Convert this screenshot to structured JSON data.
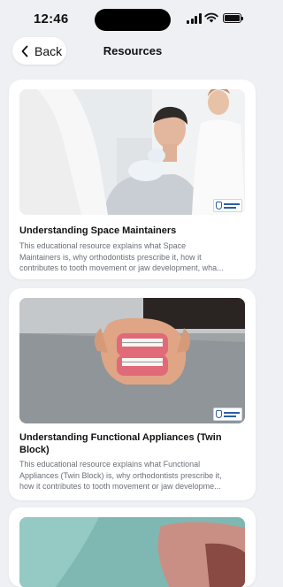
{
  "status_bar": {
    "time": "12:46"
  },
  "header": {
    "back_label": "Back",
    "title": "Resources"
  },
  "resources": [
    {
      "title": "Understanding Space Maintainers",
      "description_lines": [
        "This educational resource explains what Space",
        "Maintainers is, why orthodontists prescribe it, how it",
        "contributes to tooth movement or jaw development, wha..."
      ]
    },
    {
      "title_lines": [
        "Understanding Functional Appliances (Twin",
        "Block)"
      ],
      "description_lines": [
        "This educational resource explains what Functional",
        "Appliances (Twin Block) is, why orthodontists prescribe it,",
        "how it contributes to tooth movement or jaw developme..."
      ]
    }
  ]
}
